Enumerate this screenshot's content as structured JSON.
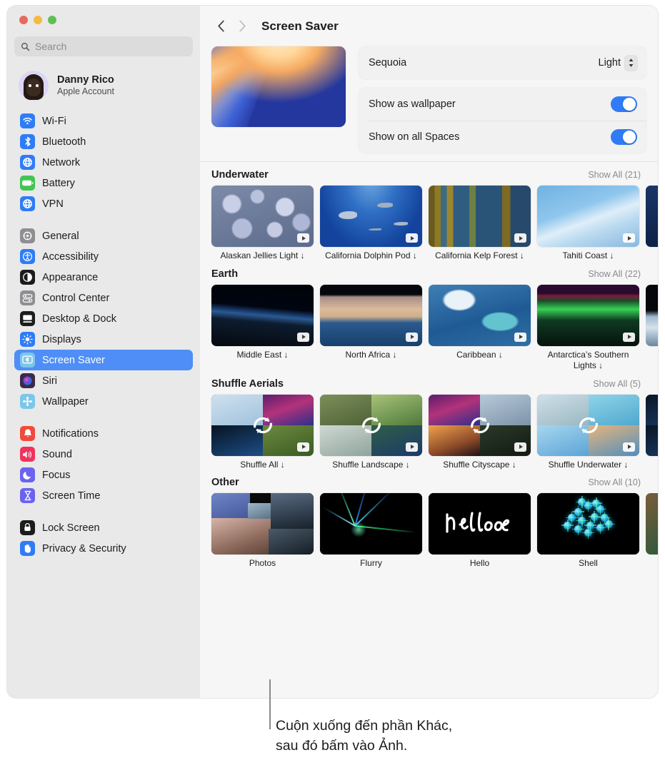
{
  "window": {
    "traffic_lights": [
      "close",
      "minimize",
      "zoom"
    ]
  },
  "sidebar": {
    "search": {
      "placeholder": "Search",
      "value": "",
      "icon": "search-icon"
    },
    "account": {
      "name": "Danny Rico",
      "subtitle": "Apple Account",
      "avatar": "memoji-avatar"
    },
    "groups": [
      {
        "items": [
          {
            "label": "Wi-Fi",
            "icon": "wifi-icon",
            "color": "#2f7cf6",
            "selected": false
          },
          {
            "label": "Bluetooth",
            "icon": "bluetooth-icon",
            "color": "#2f7cf6",
            "selected": false
          },
          {
            "label": "Network",
            "icon": "globe-icon",
            "color": "#2f7cf6",
            "selected": false
          },
          {
            "label": "Battery",
            "icon": "battery-icon",
            "color": "#42c551",
            "selected": false
          },
          {
            "label": "VPN",
            "icon": "vpn-globe-icon",
            "color": "#2f7cf6",
            "selected": false
          }
        ]
      },
      {
        "items": [
          {
            "label": "General",
            "icon": "gear-icon",
            "color": "#8e8e93",
            "selected": false
          },
          {
            "label": "Accessibility",
            "icon": "accessibility-icon",
            "color": "#2f7cf6",
            "selected": false
          },
          {
            "label": "Appearance",
            "icon": "appearance-icon",
            "color": "#1c1c1e",
            "selected": false
          },
          {
            "label": "Control Center",
            "icon": "control-center-icon",
            "color": "#8e8e93",
            "selected": false
          },
          {
            "label": "Desktop & Dock",
            "icon": "desktop-dock-icon",
            "color": "#1c1c1e",
            "selected": false
          },
          {
            "label": "Displays",
            "icon": "brightness-icon",
            "color": "#2f7cf6",
            "selected": false
          },
          {
            "label": "Screen Saver",
            "icon": "screen-saver-icon",
            "color": "#7cc7e8",
            "selected": true
          },
          {
            "label": "Siri",
            "icon": "siri-icon",
            "color": "#3a2a4a",
            "selected": false
          },
          {
            "label": "Wallpaper",
            "icon": "wallpaper-icon",
            "color": "#7cc7e8",
            "selected": false
          }
        ]
      },
      {
        "items": [
          {
            "label": "Notifications",
            "icon": "bell-icon",
            "color": "#ef4b3c",
            "selected": false
          },
          {
            "label": "Sound",
            "icon": "speaker-icon",
            "color": "#f0335c",
            "selected": false
          },
          {
            "label": "Focus",
            "icon": "moon-icon",
            "color": "#6b63ef",
            "selected": false
          },
          {
            "label": "Screen Time",
            "icon": "hourglass-icon",
            "color": "#6b63ef",
            "selected": false
          }
        ]
      },
      {
        "items": [
          {
            "label": "Lock Screen",
            "icon": "lock-icon",
            "color": "#1c1c1e",
            "selected": false
          },
          {
            "label": "Privacy & Security",
            "icon": "hand-icon",
            "color": "#2f7cf6",
            "selected": false
          }
        ]
      }
    ]
  },
  "detail": {
    "back_icon": "chevron-left-icon",
    "forward_icon": "chevron-right-icon",
    "title": "Screen Saver",
    "preview_name": "sequoia-preview",
    "options": {
      "wallpaper_row": {
        "label": "Sequoia",
        "value": "Light",
        "icon": "up-down-chevron-icon"
      },
      "toggles": [
        {
          "label": "Show as wallpaper",
          "value": "on"
        },
        {
          "label": "Show on all Spaces",
          "value": "on"
        }
      ]
    },
    "sections": [
      {
        "title": "Underwater",
        "show_all": "Show All (21)",
        "items": [
          {
            "label": "Alaskan Jellies Light ↓",
            "art": "t-jellies",
            "play": true
          },
          {
            "label": "California Dolphin Pod ↓",
            "art": "t-dolphin",
            "play": true
          },
          {
            "label": "California Kelp Forest ↓",
            "art": "t-kelp",
            "play": true
          },
          {
            "label": "Tahiti Coast ↓",
            "art": "t-tahiti",
            "play": true
          },
          {
            "label": "",
            "art": "t-under5",
            "play": false,
            "partial": true
          }
        ]
      },
      {
        "title": "Earth",
        "show_all": "Show All (22)",
        "items": [
          {
            "label": "Middle East ↓",
            "art": "t-mideast",
            "play": true
          },
          {
            "label": "North Africa ↓",
            "art": "t-nafrica",
            "play": true
          },
          {
            "label": "Caribbean ↓",
            "art": "t-carib",
            "play": true
          },
          {
            "label": "Antarctica’s Southern Lights ↓",
            "art": "t-antarctic",
            "play": true
          },
          {
            "label": "",
            "art": "t-earth5",
            "play": false,
            "partial": true
          }
        ]
      },
      {
        "title": "Shuffle Aerials",
        "show_all": "Show All (5)",
        "items": [
          {
            "label": "Shuffle All ↓",
            "art": "shuffle-a",
            "play": true,
            "shuffle": true
          },
          {
            "label": "Shuffle Landscape ↓",
            "art": "shuffle-b",
            "play": true,
            "shuffle": true
          },
          {
            "label": "Shuffle Cityscape ↓",
            "art": "shuffle-c",
            "play": true,
            "shuffle": true
          },
          {
            "label": "Shuffle Underwater ↓",
            "art": "shuffle-d",
            "play": true,
            "shuffle": true
          },
          {
            "label": "",
            "art": "shuffle-e",
            "play": false,
            "partial": true
          }
        ]
      },
      {
        "title": "Other",
        "show_all": "Show All (10)",
        "items": [
          {
            "label": "Photos",
            "art": "t-photos",
            "play": false
          },
          {
            "label": "Flurry",
            "art": "t-flurry",
            "play": false
          },
          {
            "label": "Hello",
            "art": "t-hello",
            "play": false
          },
          {
            "label": "Shell",
            "art": "t-shell",
            "play": false
          },
          {
            "label": "",
            "art": "t-other5",
            "play": false,
            "partial": true
          }
        ]
      }
    ]
  },
  "callout": {
    "line1": "Cuộn xuống đến phần Khác,",
    "line2": "sau đó bấm vào Ảnh."
  }
}
